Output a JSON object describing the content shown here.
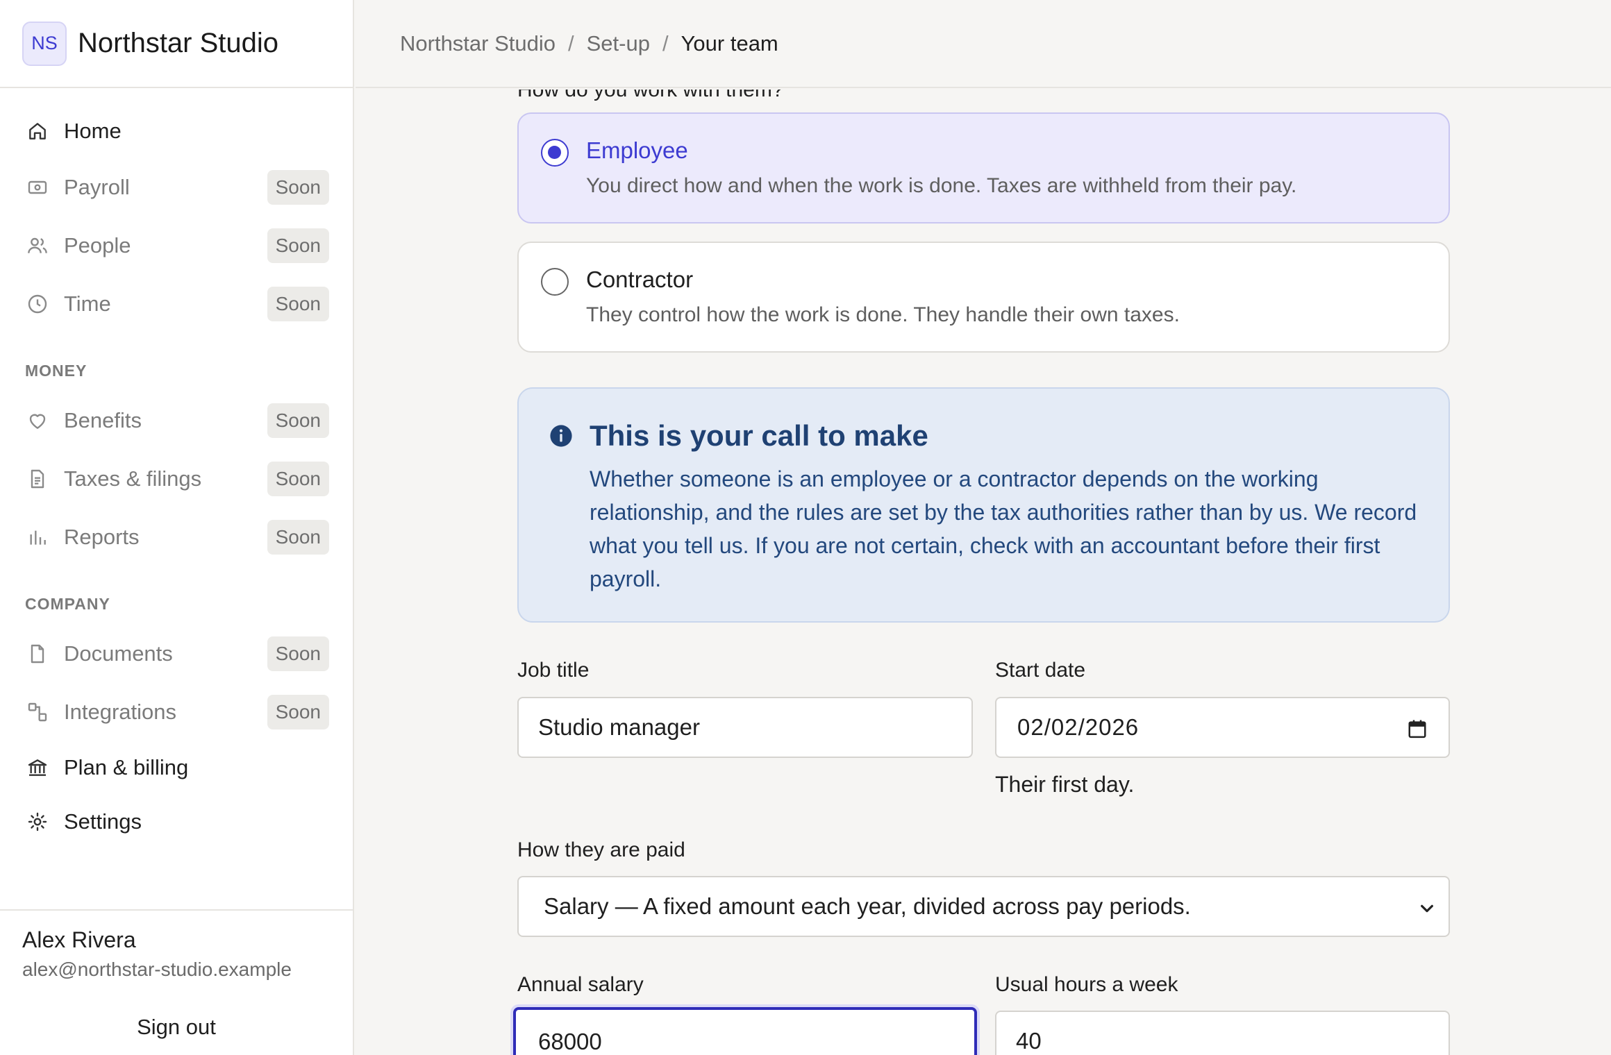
{
  "brand": {
    "initials": "NS",
    "name": "Northstar Studio"
  },
  "nav": {
    "home": "Home",
    "payroll": "Payroll",
    "people": "People",
    "time": "Time",
    "money_heading": "MONEY",
    "benefits": "Benefits",
    "taxes": "Taxes & filings",
    "reports": "Reports",
    "company_heading": "COMPANY",
    "documents": "Documents",
    "integrations": "Integrations",
    "plan": "Plan & billing",
    "settings": "Settings",
    "soon_badge": "Soon"
  },
  "user": {
    "name": "Alex Rivera",
    "email": "alex@northstar-studio.example",
    "sign_out": "Sign out"
  },
  "breadcrumb": {
    "root": "Northstar Studio",
    "step": "Set-up",
    "current": "Your team",
    "separator": "/"
  },
  "form": {
    "question": "How do you work with them?",
    "options": [
      {
        "title": "Employee",
        "description": "You direct how and when the work is done. Taxes are withheld from their pay.",
        "selected": true
      },
      {
        "title": "Contractor",
        "description": "They control how the work is done. They handle their own taxes.",
        "selected": false
      }
    ],
    "info": {
      "title": "This is your call to make",
      "text": "Whether someone is an employee or a contractor depends on the working relationship, and the rules are set by the tax authorities rather than by us. We record what you tell us. If you are not certain, check with an accountant before their first payroll."
    },
    "job_title": {
      "label": "Job title",
      "value": "Studio manager"
    },
    "start_date": {
      "label": "Start date",
      "value": "02/02/2026",
      "helper": "Their first day."
    },
    "pay_type": {
      "label": "How they are paid",
      "selected": "Salary — A fixed amount each year, divided across pay periods."
    },
    "annual_salary": {
      "label": "Annual salary",
      "value": "68000"
    },
    "hours": {
      "label": "Usual hours a week",
      "value": "40"
    }
  },
  "colors": {
    "accent": "#3d3bd1",
    "info_bg": "#e4ebf6",
    "info_text": "#1f4173",
    "selected_card_bg": "#eceafc"
  }
}
